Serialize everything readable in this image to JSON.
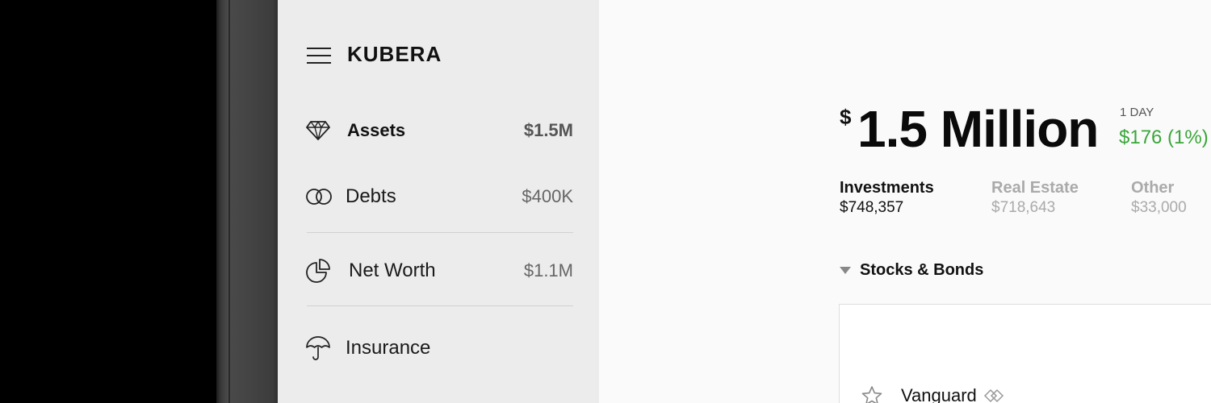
{
  "app": {
    "brand": "KUBERA"
  },
  "sidebar": {
    "items": [
      {
        "label": "Assets",
        "value": "$1.5M",
        "icon": "diamond-icon",
        "active": true
      },
      {
        "label": "Debts",
        "value": "$400K",
        "icon": "linked-circles-icon"
      },
      {
        "label": "Net Worth",
        "value": "$1.1M",
        "icon": "pie-chart-icon"
      },
      {
        "label": "Insurance",
        "value": "",
        "icon": "umbrella-icon"
      }
    ]
  },
  "summary": {
    "currency": "$",
    "value": "1.5 Million",
    "period_label": "1 DAY",
    "change": "$176 (1%)",
    "change_color": "#3aa63a"
  },
  "categories": [
    {
      "name": "Investments",
      "value": "$748,357",
      "active": true
    },
    {
      "name": "Real Estate",
      "value": "$718,643"
    },
    {
      "name": "Other",
      "value": "$33,000"
    }
  ],
  "section": {
    "title": "Stocks & Bonds"
  },
  "holdings": [
    {
      "name": "Vanguard",
      "icon": "star-icon"
    }
  ]
}
